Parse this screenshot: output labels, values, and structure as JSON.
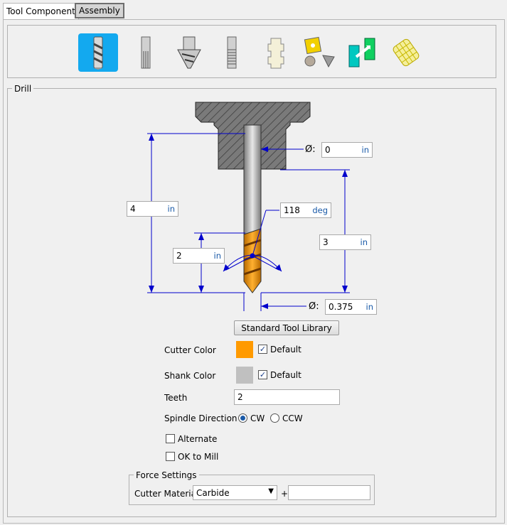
{
  "tabs": [
    {
      "label": "Tool Component",
      "active": true
    },
    {
      "label": "Assembly",
      "active": false
    }
  ],
  "toolbar": {
    "icons": [
      "drill-icon",
      "reamer-icon",
      "countersink-icon",
      "tap-icon",
      "mill-icon",
      "insert-icon",
      "adapter-icon",
      "cage-icon"
    ],
    "selected": "drill-icon"
  },
  "group": {
    "title": "Drill"
  },
  "dimensions": {
    "shank_diameter": {
      "value": "0",
      "unit": "in"
    },
    "overall_length": {
      "value": "4",
      "unit": "in"
    },
    "point_angle": {
      "value": "118",
      "unit": "deg"
    },
    "flute_length": {
      "value": "2",
      "unit": "in"
    },
    "stickout_length": {
      "value": "3",
      "unit": "in"
    },
    "cutter_diameter": {
      "value": "0.375",
      "unit": "in"
    },
    "diameter_symbol": "Ø:"
  },
  "buttons": {
    "standard_library": "Standard Tool Library"
  },
  "cutter_color": {
    "label": "Cutter Color",
    "color": "#ff9a00",
    "default_label": "Default",
    "default_checked": true
  },
  "shank_color": {
    "label": "Shank Color",
    "color": "#c0c0c0",
    "default_label": "Default",
    "default_checked": true
  },
  "teeth": {
    "label": "Teeth",
    "value": "2"
  },
  "spindle": {
    "label": "Spindle Direction",
    "options": [
      "CW",
      "CCW"
    ],
    "selected": "CW"
  },
  "alternate": {
    "label": "Alternate",
    "checked": false
  },
  "ok_to_mill": {
    "label": "OK to Mill",
    "checked": false
  },
  "force": {
    "title": "Force Settings",
    "material_label": "Cutter Material",
    "material": "Carbide",
    "plus": "+",
    "extra_value": ""
  },
  "colors": {
    "accent": "#13a9ef",
    "dim_line": "#0000cc"
  }
}
